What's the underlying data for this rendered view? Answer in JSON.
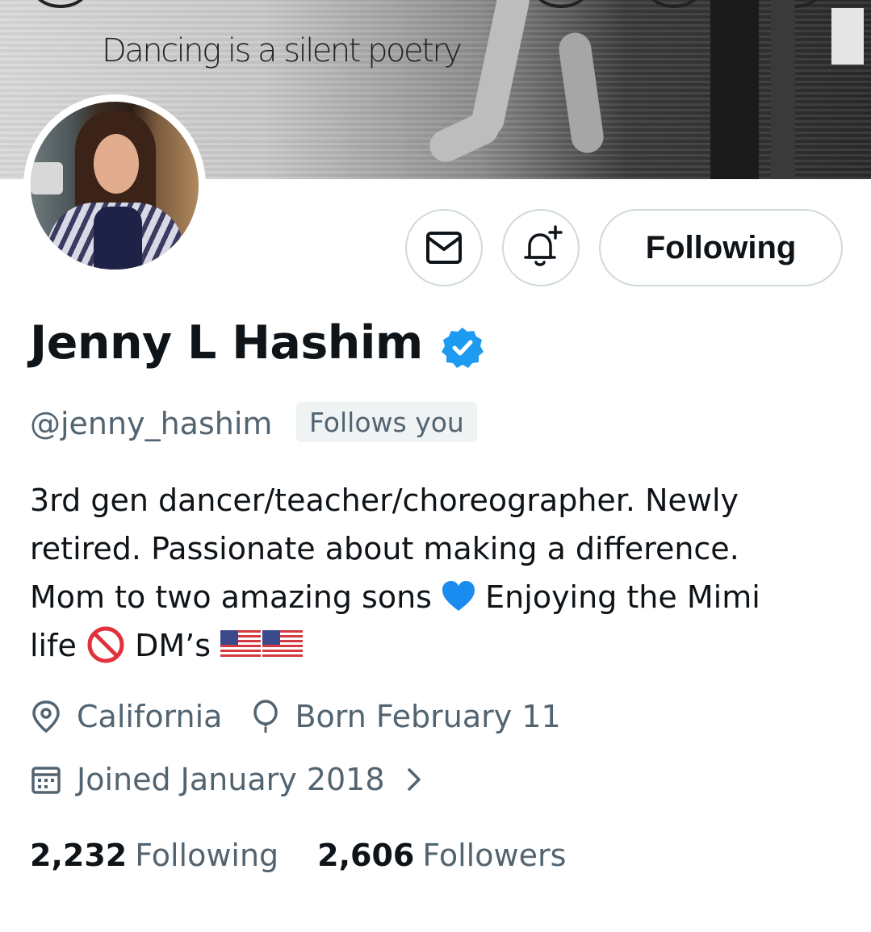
{
  "banner": {
    "caption": "Dancing is a silent poetry"
  },
  "actions": {
    "message_icon": "mail-icon",
    "notify_icon": "bell-plus-icon",
    "follow_label": "Following"
  },
  "profile": {
    "display_name": "Jenny L Hashim",
    "verified_color": "#1d9bf0",
    "handle": "@jenny_hashim",
    "follows_you": "Follows you",
    "bio_lines": [
      "3rd gen dancer/teacher/choreographer. Newly",
      "retired. Passionate about making a difference.",
      "Mom to two amazing sons",
      "Enjoying the Mimi",
      "life",
      "DM’s"
    ],
    "location": "California",
    "birthday": "Born February 11",
    "joined": "Joined January 2018"
  },
  "stats": {
    "following_count": "2,232",
    "following_label": "Following",
    "followers_count": "2,606",
    "followers_label": "Followers"
  },
  "colors": {
    "text_primary": "#0f1419",
    "text_secondary": "#536471",
    "border": "#cfd9de",
    "accent": "#1d9bf0"
  }
}
